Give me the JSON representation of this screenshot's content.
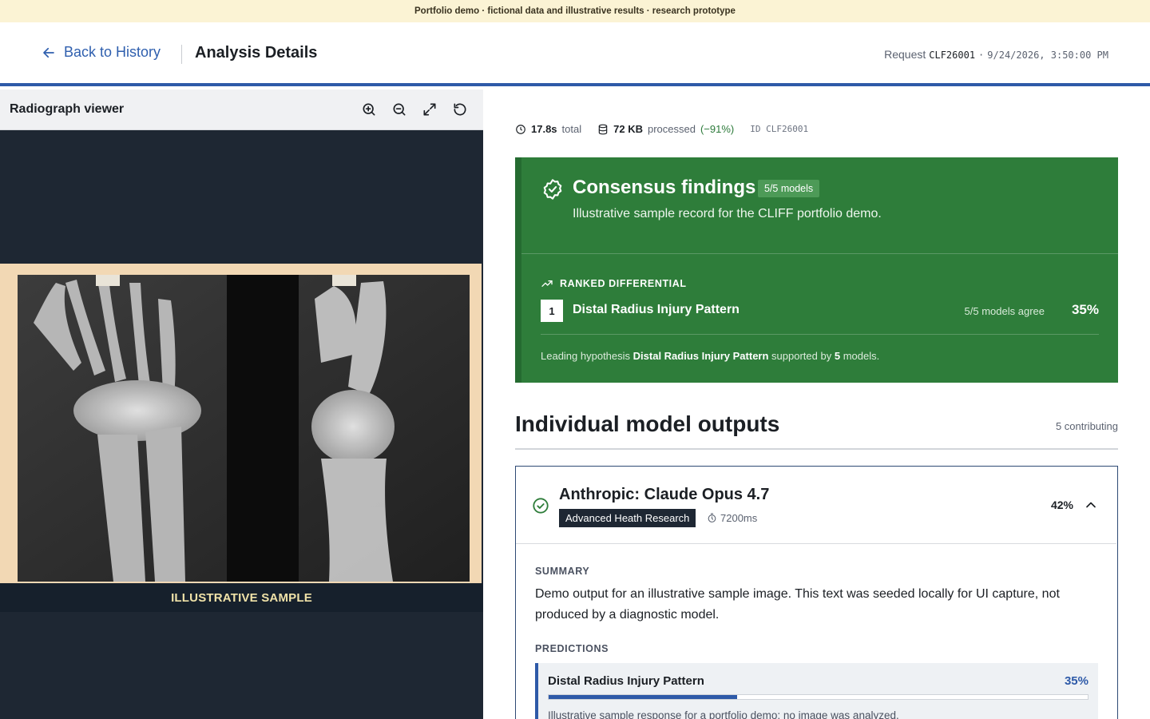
{
  "banner": {
    "text": "Portfolio demo · fictional data and illustrative results · research prototype"
  },
  "header": {
    "back_label": "Back to History",
    "title": "Analysis Details",
    "request_label": "Request",
    "request_id": "CLF26001",
    "separator": "·",
    "timestamp": "9/24/2026, 3:50:00 PM"
  },
  "viewer": {
    "title": "Radiograph viewer",
    "tools": [
      "zoom-in-icon",
      "zoom-out-icon",
      "expand-icon",
      "reset-rotate-icon"
    ],
    "caption": "ILLUSTRATIVE SAMPLE"
  },
  "stats": {
    "time_value": "17.8s",
    "time_label": "total",
    "size_value": "72 KB",
    "size_label": "processed",
    "size_delta": "(−91%)",
    "id_text": "ID CLF26001"
  },
  "consensus": {
    "title": "Consensus findings",
    "badge": "5/5 models",
    "subtitle": "Illustrative sample record for the CLIFF portfolio demo.",
    "ranked_header": "RANKED DIFFERENTIAL",
    "ranks": [
      {
        "rank": "1",
        "label": "Distal Radius Injury Pattern",
        "agree": "5/5 models agree",
        "pct": "35%"
      }
    ],
    "leading_prefix": "Leading hypothesis",
    "leading_name": "Distal Radius Injury Pattern",
    "leading_mid": "supported by",
    "leading_count": "5",
    "leading_suffix": "models.",
    "accent": "#2e7d3a"
  },
  "outputs": {
    "title": "Individual model outputs",
    "count": "5 contributing",
    "models": [
      {
        "name": "Anthropic: Claude Opus 4.7",
        "org": "Advanced Heath Research",
        "latency": "7200ms",
        "pct": "42%",
        "summary_label": "SUMMARY",
        "summary": "Demo output for an illustrative sample image. This text was seeded locally for UI capture, not produced by a diagnostic model.",
        "predictions_label": "PREDICTIONS",
        "predictions": [
          {
            "label": "Distal Radius Injury Pattern",
            "pct": "35%",
            "value": 0.35,
            "note": "Illustrative sample response for a portfolio demo; no image was analyzed."
          }
        ]
      }
    ]
  },
  "colors": {
    "brand_blue": "#2e5aa8",
    "consensus_green": "#2e7d3a",
    "viewer_bg": "#1e2733",
    "banner_bg": "#fbf3d4"
  }
}
